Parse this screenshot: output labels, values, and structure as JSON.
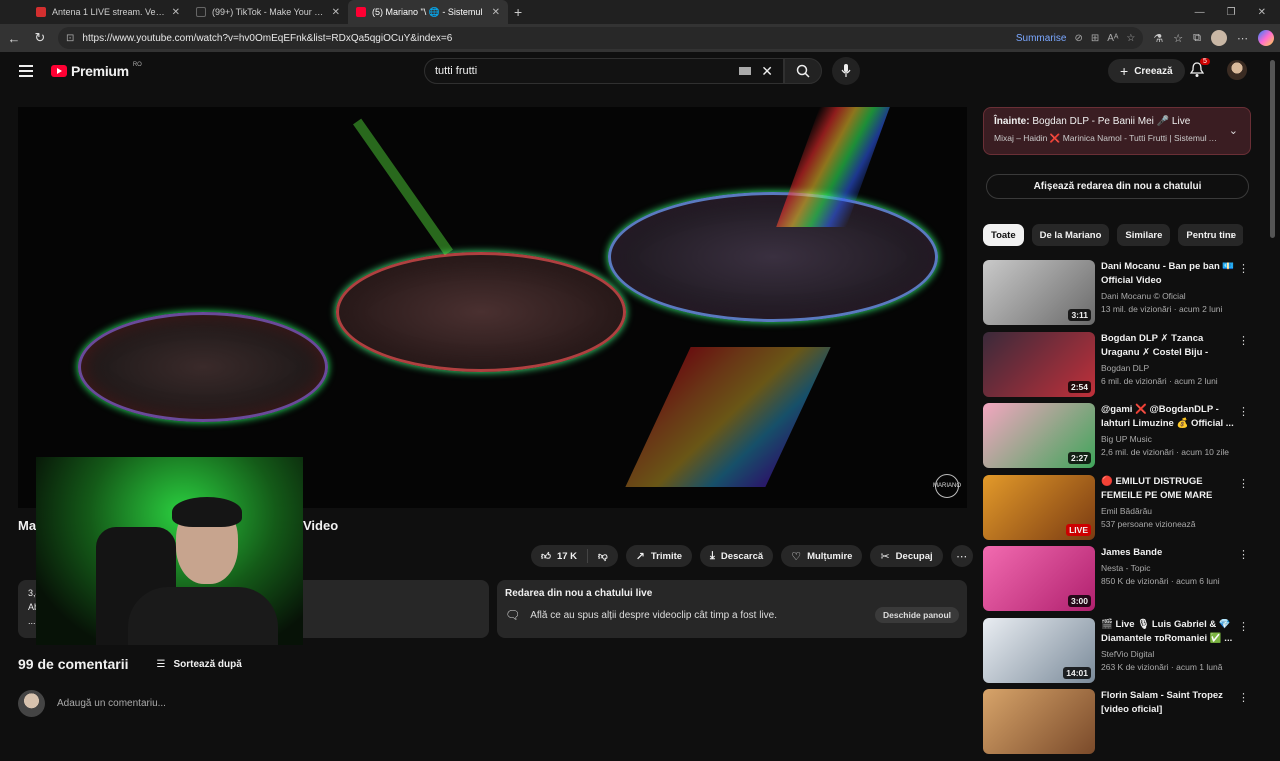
{
  "browser": {
    "tabs": [
      {
        "label": "Antena 1 LIVE stream. Vezi online",
        "color": "#d32f2f",
        "active": false
      },
      {
        "label": "(99+) TikTok - Make Your Day",
        "color": "#222222",
        "active": false
      },
      {
        "label": "(5) Mariano \"\\ 🌐 - Sistemul",
        "color": "#ff0033",
        "active": true
      }
    ],
    "url": "https://www.youtube.com/watch?v=hv0OmEqEFnk&list=RDxQa5qgiOCuY&index=6",
    "summarize": "Summarise"
  },
  "header": {
    "logo_text": "Premium",
    "region": "RO",
    "search_value": "tutti frutti",
    "create_label": "Creează",
    "notif_count": "5"
  },
  "video": {
    "title_left": "Ma",
    "title_right": "Video",
    "likes": "17 K",
    "actions": {
      "share": "Trimite",
      "download": "Descarcă",
      "thanks": "Mulțumire",
      "clip": "Decupaj"
    },
    "desc_line1": "3,4",
    "desc_line2": "Ab",
    "desc_line3": "..."
  },
  "chat_replay": {
    "heading": "Redarea din nou a chatului live",
    "text": "Află ce au spus alții despre videoclip cât timp a fost live.",
    "button": "Deschide panoul"
  },
  "comments": {
    "count": "99 de comentarii",
    "sort": "Sortează după",
    "placeholder": "Adaugă un comentariu..."
  },
  "sidebar": {
    "up_next_label": "Înainte:",
    "up_next_title": "Bogdan DLP - Pe Banii Mei 🎤 Live",
    "up_next_sub": "Mixaj – Haidin ❌ Marinica Namol - Tutti Frutti | Sistemul An...",
    "replay_button": "Afișează redarea din nou a chatului",
    "chips": [
      "Toate",
      "De la Mariano",
      "Similare",
      "Pentru tine"
    ],
    "recs": [
      {
        "title": "Dani Mocanu - Ban pe ban 💶 Official Video",
        "channel": "Dani Mocanu © Oficial",
        "meta": "13 mil. de vizionări · acum 2 luni",
        "duration": "3:11",
        "live": false,
        "thumb": [
          "#c9c9c9",
          "#6a6a6a"
        ]
      },
      {
        "title": "Bogdan DLP ✗ Tzanca Uraganu ✗ Costel Biju - Racheta 🚀 ...",
        "channel": "Bogdan DLP",
        "meta": "6 mil. de vizionări · acum 2 luni",
        "duration": "2:54",
        "live": false,
        "thumb": [
          "#3a2a3a",
          "#c0303a"
        ]
      },
      {
        "title": "@gami ❌ @BogdanDLP - Iahturi Limuzine 💰 Official ...",
        "channel": "Big UP Music",
        "meta": "2,6 mil. de vizionări · acum 10 zile",
        "duration": "2:27",
        "live": false,
        "thumb": [
          "#f3a6c0",
          "#3fa55a"
        ]
      },
      {
        "title": "🔴 EMILUT DISTRUGE FEMEILE PE OME MARE NEBUNIE / ...",
        "channel": "Emil Bădărău",
        "meta": "537 persoane vizionează",
        "duration": "LIVE",
        "live": true,
        "thumb": [
          "#e39a2a",
          "#7a3b12"
        ]
      },
      {
        "title": "James Bande",
        "channel": "Nesta - Topic",
        "meta": "850 K de vizionări · acum 6 luni",
        "duration": "3:00",
        "live": false,
        "thumb": [
          "#f26bb0",
          "#b0206e"
        ]
      },
      {
        "title": "🎬 Live 🎙 Luis Gabriel & 💎 Diamantele ᴛᴅRomaniei ✅ ...",
        "channel": "StefVio Digital",
        "meta": "263 K de vizionări · acum 1 lună",
        "duration": "14:01",
        "live": false,
        "thumb": [
          "#e9edf2",
          "#7b8b9a"
        ]
      },
      {
        "title": "Florin Salam - Saint Tropez [video oficial]",
        "channel": "",
        "meta": "",
        "duration": "",
        "live": false,
        "thumb": [
          "#d7a46a",
          "#7a4a2a"
        ]
      }
    ]
  }
}
